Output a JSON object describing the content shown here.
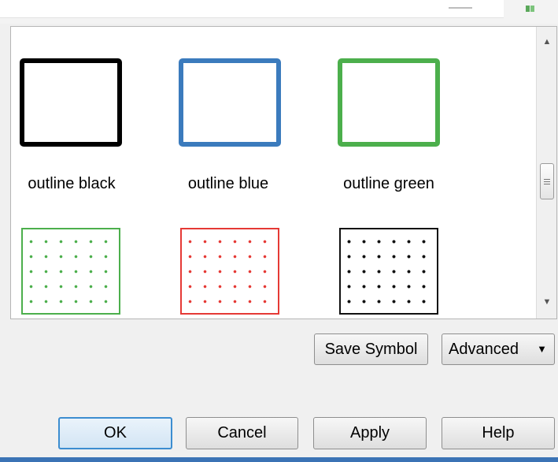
{
  "symbols": [
    {
      "label": "outline black",
      "style": "outline",
      "color": "#000000"
    },
    {
      "label": "outline blue",
      "style": "outline",
      "color": "#3b7bbd"
    },
    {
      "label": "outline green",
      "style": "outline",
      "color": "#4caf4c"
    },
    {
      "label": "",
      "style": "dotted",
      "color": "#4caf4c"
    },
    {
      "label": "",
      "style": "dotted",
      "color": "#e53935"
    },
    {
      "label": "",
      "style": "dotted",
      "color": "#111111"
    }
  ],
  "buttons": {
    "save_symbol": "Save Symbol",
    "advanced": "Advanced",
    "advanced_arrow": "▼",
    "ok": "OK",
    "cancel": "Cancel",
    "apply": "Apply",
    "help": "Help"
  },
  "scrollbar": {
    "up_arrow": "▲",
    "down_arrow": "▼"
  },
  "colors": {
    "default_button_border": "#3c8dd0",
    "window_frame": "#3b73b5"
  }
}
